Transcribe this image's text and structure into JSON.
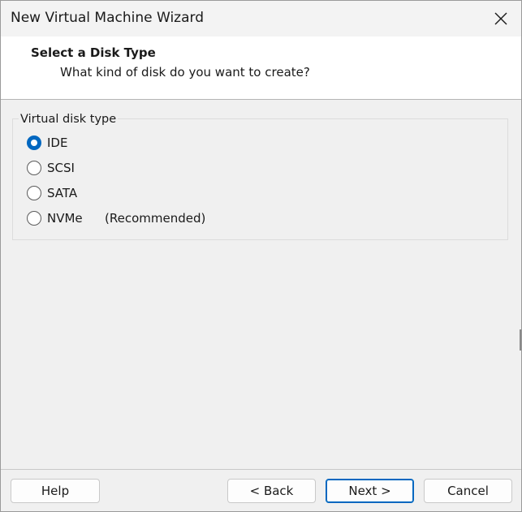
{
  "window": {
    "title": "New Virtual Machine Wizard"
  },
  "header": {
    "title": "Select a Disk Type",
    "subtitle": "What kind of disk do you want to create?"
  },
  "disk_type_group": {
    "legend": "Virtual disk type",
    "selected": "IDE",
    "options": [
      {
        "label": "IDE",
        "note": ""
      },
      {
        "label": "SCSI",
        "note": ""
      },
      {
        "label": "SATA",
        "note": ""
      },
      {
        "label": "NVMe",
        "note": "(Recommended)"
      }
    ]
  },
  "footer": {
    "help_label": "Help",
    "back_label": "< Back",
    "next_label": "Next >",
    "cancel_label": "Cancel"
  },
  "colors": {
    "accent": "#0067c0",
    "background": "#f0f0f0",
    "header_background": "#ffffff"
  },
  "icons": {
    "close": "close-icon"
  }
}
